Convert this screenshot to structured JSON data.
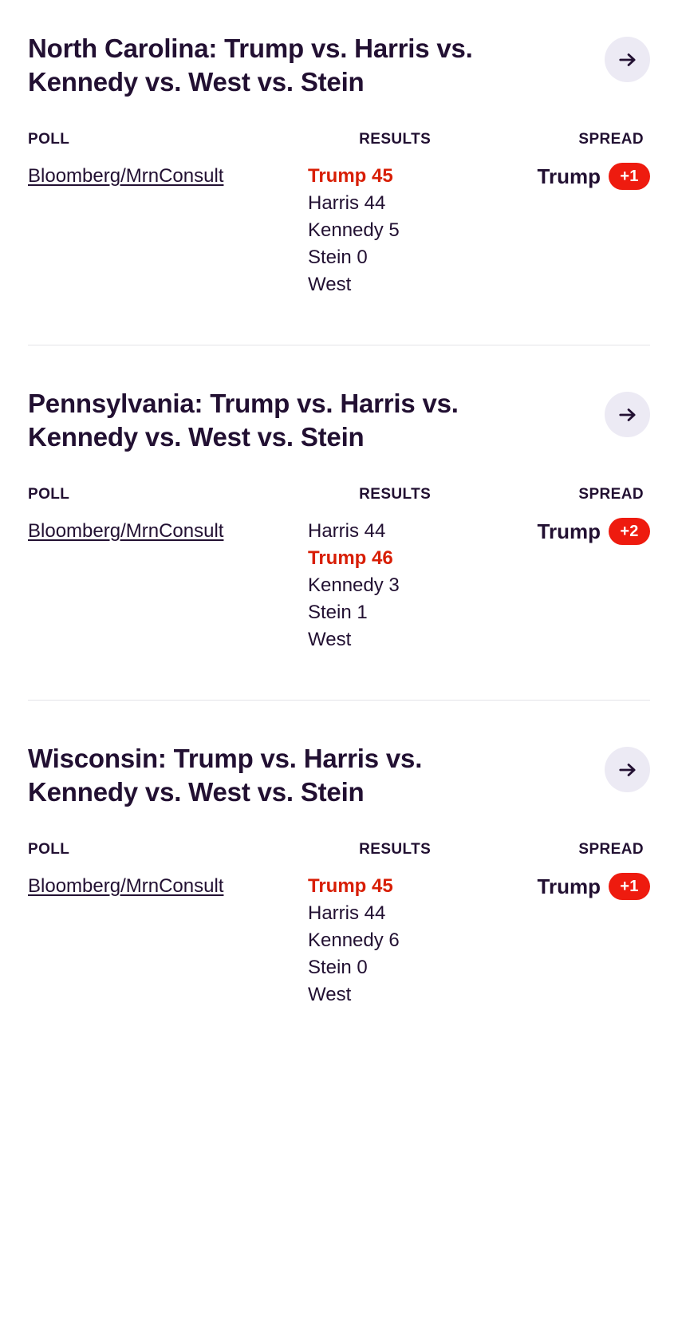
{
  "table_headers": {
    "poll": "POLL",
    "results": "RESULTS",
    "spread": "SPREAD"
  },
  "colors": {
    "headline": "#221032",
    "leader_red": "#D81E05",
    "badge_red": "#EE1B0F",
    "arrow_circle": "#ECEAF4",
    "divider": "#E3E3E8",
    "background": "#FFFFFF"
  },
  "icons": {
    "arrow_right": "arrow-right-icon"
  },
  "sections": [
    {
      "headline": "North Carolina: Trump vs. Harris vs. Kennedy vs. West vs. Stein",
      "state": "North Carolina",
      "arrow_label": "→",
      "rows": [
        {
          "pollster": "Bloomberg/MrnConsult",
          "results": [
            {
              "candidate": "Trump",
              "value": "45",
              "text": "Trump 45",
              "leader": true
            },
            {
              "candidate": "Harris",
              "value": "44",
              "text": "Harris 44",
              "leader": false
            },
            {
              "candidate": "Kennedy",
              "value": "5",
              "text": "Kennedy 5",
              "leader": false
            },
            {
              "candidate": "Stein",
              "value": "0",
              "text": "Stein 0",
              "leader": false
            },
            {
              "candidate": "West",
              "value": "",
              "text": "West",
              "leader": false
            }
          ],
          "spread_name": "Trump",
          "spread_value": "+1"
        }
      ]
    },
    {
      "headline": "Pennsylvania: Trump vs. Harris vs. Kennedy vs. West vs. Stein",
      "state": "Pennsylvania",
      "arrow_label": "→",
      "rows": [
        {
          "pollster": "Bloomberg/MrnConsult",
          "results": [
            {
              "candidate": "Harris",
              "value": "44",
              "text": "Harris 44",
              "leader": false
            },
            {
              "candidate": "Trump",
              "value": "46",
              "text": "Trump 46",
              "leader": true
            },
            {
              "candidate": "Kennedy",
              "value": "3",
              "text": "Kennedy 3",
              "leader": false
            },
            {
              "candidate": "Stein",
              "value": "1",
              "text": "Stein 1",
              "leader": false
            },
            {
              "candidate": "West",
              "value": "",
              "text": "West",
              "leader": false
            }
          ],
          "spread_name": "Trump",
          "spread_value": "+2"
        }
      ]
    },
    {
      "headline": "Wisconsin: Trump vs. Harris vs. Kennedy vs. West vs. Stein",
      "state": "Wisconsin",
      "arrow_label": "→",
      "rows": [
        {
          "pollster": "Bloomberg/MrnConsult",
          "results": [
            {
              "candidate": "Trump",
              "value": "45",
              "text": "Trump 45",
              "leader": true
            },
            {
              "candidate": "Harris",
              "value": "44",
              "text": "Harris 44",
              "leader": false
            },
            {
              "candidate": "Kennedy",
              "value": "6",
              "text": "Kennedy 6",
              "leader": false
            },
            {
              "candidate": "Stein",
              "value": "0",
              "text": "Stein 0",
              "leader": false
            },
            {
              "candidate": "West",
              "value": "",
              "text": "West",
              "leader": false
            }
          ],
          "spread_name": "Trump",
          "spread_value": "+1"
        }
      ]
    }
  ]
}
